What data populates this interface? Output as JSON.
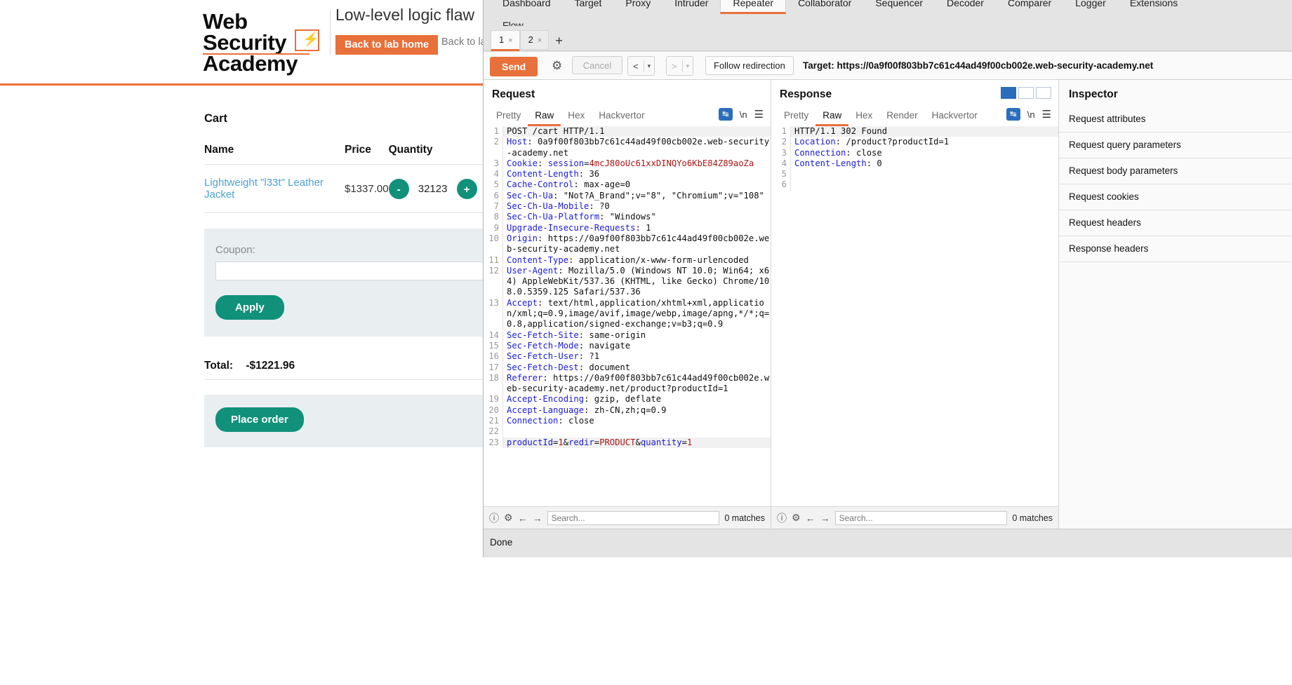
{
  "webpage": {
    "logo": {
      "line1": "Web Security",
      "line2": "Academy",
      "bolt": "⚡"
    },
    "lab_title": "Low-level logic flaw",
    "lab_home_button": "Back to lab home",
    "back_link": "Back to lab description",
    "cart_heading": "Cart",
    "table": {
      "headers": [
        "Name",
        "Price",
        "Quantity",
        ""
      ],
      "rows": [
        {
          "name": "Lightweight \"l33t\" Leather Jacket",
          "price": "$1337.00",
          "qty_minus": "-",
          "qty_value": "32123",
          "qty_plus": "+"
        }
      ]
    },
    "coupon_label": "Coupon:",
    "coupon_value": "",
    "coupon_placeholder": "",
    "apply_button": "Apply",
    "total_label": "Total:",
    "total_value": "-$1221.96",
    "place_order_button": "Place order"
  },
  "burp": {
    "main_tabs": [
      {
        "label": "Dashboard",
        "active": false
      },
      {
        "label": "Target",
        "active": false
      },
      {
        "label": "Proxy",
        "active": false
      },
      {
        "label": "Intruder",
        "active": false
      },
      {
        "label": "Repeater",
        "active": true
      },
      {
        "label": "Collaborator",
        "active": false
      },
      {
        "label": "Sequencer",
        "active": false
      },
      {
        "label": "Decoder",
        "active": false
      },
      {
        "label": "Comparer",
        "active": false
      },
      {
        "label": "Logger",
        "active": false
      },
      {
        "label": "Extensions",
        "active": false
      }
    ],
    "second_row_tab": "Flow",
    "repeater_tabs": [
      {
        "label": "1",
        "close": "×",
        "active": true
      },
      {
        "label": "2",
        "close": "×",
        "active": false
      }
    ],
    "repeater_add": "+",
    "toolbar": {
      "send": "Send",
      "gear_icon": "gear-icon",
      "cancel": "Cancel",
      "back_arrow": "<",
      "forward_arrow": ">",
      "caret": "▾",
      "follow_redirection": "Follow redirection",
      "target": "Target: https://0a9f00f803bb7c61c44ad49f00cb002e.web-security-academy.net"
    },
    "request": {
      "title": "Request",
      "tabs": [
        {
          "label": "Pretty",
          "active": false
        },
        {
          "label": "Raw",
          "active": true
        },
        {
          "label": "Hex",
          "active": false
        },
        {
          "label": "Hackvertor",
          "active": false
        }
      ],
      "icons": [
        "wrap-lines-icon",
        "\\n",
        "hamburger-icon"
      ],
      "lines": [
        {
          "n": "1",
          "segments": [
            {
              "t": "POST /cart HTTP/1.1",
              "c": "v"
            }
          ],
          "hl": true
        },
        {
          "n": "2",
          "segments": [
            {
              "t": "Host",
              "c": "k"
            },
            {
              "t": ": 0a9f00f803bb7c61c44ad49f00cb002e.web-security-academy.net",
              "c": "v"
            }
          ]
        },
        {
          "n": "3",
          "segments": [
            {
              "t": "Cookie",
              "c": "k"
            },
            {
              "t": ": ",
              "c": "v"
            },
            {
              "t": "session",
              "c": "k"
            },
            {
              "t": "=",
              "c": "v"
            },
            {
              "t": "4mcJ80oUc61xxDINQYo6KbE84Z89aoZa",
              "c": "r"
            }
          ]
        },
        {
          "n": "4",
          "segments": [
            {
              "t": "Content-Length",
              "c": "k"
            },
            {
              "t": ": 36",
              "c": "v"
            }
          ]
        },
        {
          "n": "5",
          "segments": [
            {
              "t": "Cache-Control",
              "c": "k"
            },
            {
              "t": ": max-age=0",
              "c": "v"
            }
          ]
        },
        {
          "n": "6",
          "segments": [
            {
              "t": "Sec-Ch-Ua",
              "c": "k"
            },
            {
              "t": ": \"Not?A_Brand\";v=\"8\", \"Chromium\";v=\"108\"",
              "c": "v"
            }
          ]
        },
        {
          "n": "7",
          "segments": [
            {
              "t": "Sec-Ch-Ua-Mobile",
              "c": "k"
            },
            {
              "t": ": ?0",
              "c": "v"
            }
          ]
        },
        {
          "n": "8",
          "segments": [
            {
              "t": "Sec-Ch-Ua-Platform",
              "c": "k"
            },
            {
              "t": ": \"Windows\"",
              "c": "v"
            }
          ]
        },
        {
          "n": "9",
          "segments": [
            {
              "t": "Upgrade-Insecure-Requests",
              "c": "k"
            },
            {
              "t": ": 1",
              "c": "v"
            }
          ]
        },
        {
          "n": "10",
          "segments": [
            {
              "t": "Origin",
              "c": "k"
            },
            {
              "t": ": https://0a9f00f803bb7c61c44ad49f00cb002e.web-security-academy.net",
              "c": "v"
            }
          ]
        },
        {
          "n": "11",
          "segments": [
            {
              "t": "Content-Type",
              "c": "k"
            },
            {
              "t": ": application/x-www-form-urlencoded",
              "c": "v"
            }
          ]
        },
        {
          "n": "12",
          "segments": [
            {
              "t": "User-Agent",
              "c": "k"
            },
            {
              "t": ": Mozilla/5.0 (Windows NT 10.0; Win64; x64) AppleWebKit/537.36 (KHTML, like Gecko) Chrome/108.0.5359.125 Safari/537.36",
              "c": "v"
            }
          ]
        },
        {
          "n": "13",
          "segments": [
            {
              "t": "Accept",
              "c": "k"
            },
            {
              "t": ": text/html,application/xhtml+xml,application/xml;q=0.9,image/avif,image/webp,image/apng,*/*;q=0.8,application/signed-exchange;v=b3;q=0.9",
              "c": "v"
            }
          ]
        },
        {
          "n": "14",
          "segments": [
            {
              "t": "Sec-Fetch-Site",
              "c": "k"
            },
            {
              "t": ": same-origin",
              "c": "v"
            }
          ]
        },
        {
          "n": "15",
          "segments": [
            {
              "t": "Sec-Fetch-Mode",
              "c": "k"
            },
            {
              "t": ": navigate",
              "c": "v"
            }
          ]
        },
        {
          "n": "16",
          "segments": [
            {
              "t": "Sec-Fetch-User",
              "c": "k"
            },
            {
              "t": ": ?1",
              "c": "v"
            }
          ]
        },
        {
          "n": "17",
          "segments": [
            {
              "t": "Sec-Fetch-Dest",
              "c": "k"
            },
            {
              "t": ": document",
              "c": "v"
            }
          ]
        },
        {
          "n": "18",
          "segments": [
            {
              "t": "Referer",
              "c": "k"
            },
            {
              "t": ": https://0a9f00f803bb7c61c44ad49f00cb002e.web-security-academy.net/product?productId=1",
              "c": "v"
            }
          ]
        },
        {
          "n": "19",
          "segments": [
            {
              "t": "Accept-Encoding",
              "c": "k"
            },
            {
              "t": ": gzip, deflate",
              "c": "v"
            }
          ]
        },
        {
          "n": "20",
          "segments": [
            {
              "t": "Accept-Language",
              "c": "k"
            },
            {
              "t": ": zh-CN,zh;q=0.9",
              "c": "v"
            }
          ]
        },
        {
          "n": "21",
          "segments": [
            {
              "t": "Connection",
              "c": "k"
            },
            {
              "t": ": close",
              "c": "v"
            }
          ]
        },
        {
          "n": "22",
          "segments": [
            {
              "t": "",
              "c": "v"
            }
          ]
        },
        {
          "n": "23",
          "segments": [
            {
              "t": "productId",
              "c": "k"
            },
            {
              "t": "=",
              "c": "v"
            },
            {
              "t": "1",
              "c": "r"
            },
            {
              "t": "&",
              "c": "v"
            },
            {
              "t": "redir",
              "c": "k"
            },
            {
              "t": "=",
              "c": "v"
            },
            {
              "t": "PRODUCT",
              "c": "r"
            },
            {
              "t": "&",
              "c": "v"
            },
            {
              "t": "quantity",
              "c": "k"
            },
            {
              "t": "=",
              "c": "v"
            },
            {
              "t": "1",
              "c": "r"
            }
          ],
          "hl": true
        }
      ],
      "footer": {
        "help_icon": "help-icon",
        "gear_icon": "gear-icon",
        "prev_icon": "←",
        "next_icon": "→",
        "search_placeholder": "Search...",
        "matches": "0 matches"
      }
    },
    "response": {
      "title": "Response",
      "tabs": [
        {
          "label": "Pretty",
          "active": false
        },
        {
          "label": "Raw",
          "active": true
        },
        {
          "label": "Hex",
          "active": false
        },
        {
          "label": "Render",
          "active": false
        },
        {
          "label": "Hackvertor",
          "active": false
        }
      ],
      "lines": [
        {
          "n": "1",
          "segments": [
            {
              "t": "HTTP/1.1 302 Found",
              "c": "v"
            }
          ],
          "hl": true
        },
        {
          "n": "2",
          "segments": [
            {
              "t": "Location",
              "c": "k"
            },
            {
              "t": ": /product?productId=1",
              "c": "v"
            }
          ]
        },
        {
          "n": "3",
          "segments": [
            {
              "t": "Connection",
              "c": "k"
            },
            {
              "t": ": close",
              "c": "v"
            }
          ]
        },
        {
          "n": "4",
          "segments": [
            {
              "t": "Content-Length",
              "c": "k"
            },
            {
              "t": ": 0",
              "c": "v"
            }
          ]
        },
        {
          "n": "5",
          "segments": [
            {
              "t": "",
              "c": "v"
            }
          ]
        },
        {
          "n": "6",
          "segments": [
            {
              "t": "",
              "c": "v"
            }
          ]
        }
      ],
      "footer": {
        "help_icon": "help-icon",
        "gear_icon": "gear-icon",
        "prev_icon": "←",
        "next_icon": "→",
        "search_placeholder": "Search...",
        "matches": "0 matches"
      }
    },
    "inspector": {
      "title": "Inspector",
      "items": [
        "Request attributes",
        "Request query parameters",
        "Request body parameters",
        "Request cookies",
        "Request headers",
        "Response headers"
      ]
    },
    "status": "Done"
  },
  "colors": {
    "accent_orange": "#e8703a",
    "teal": "#11917a",
    "link_blue": "#4ba3d6",
    "burp_gray": "#e4e4e4",
    "code_key": "#1a1ad6",
    "code_red": "#b01515"
  }
}
